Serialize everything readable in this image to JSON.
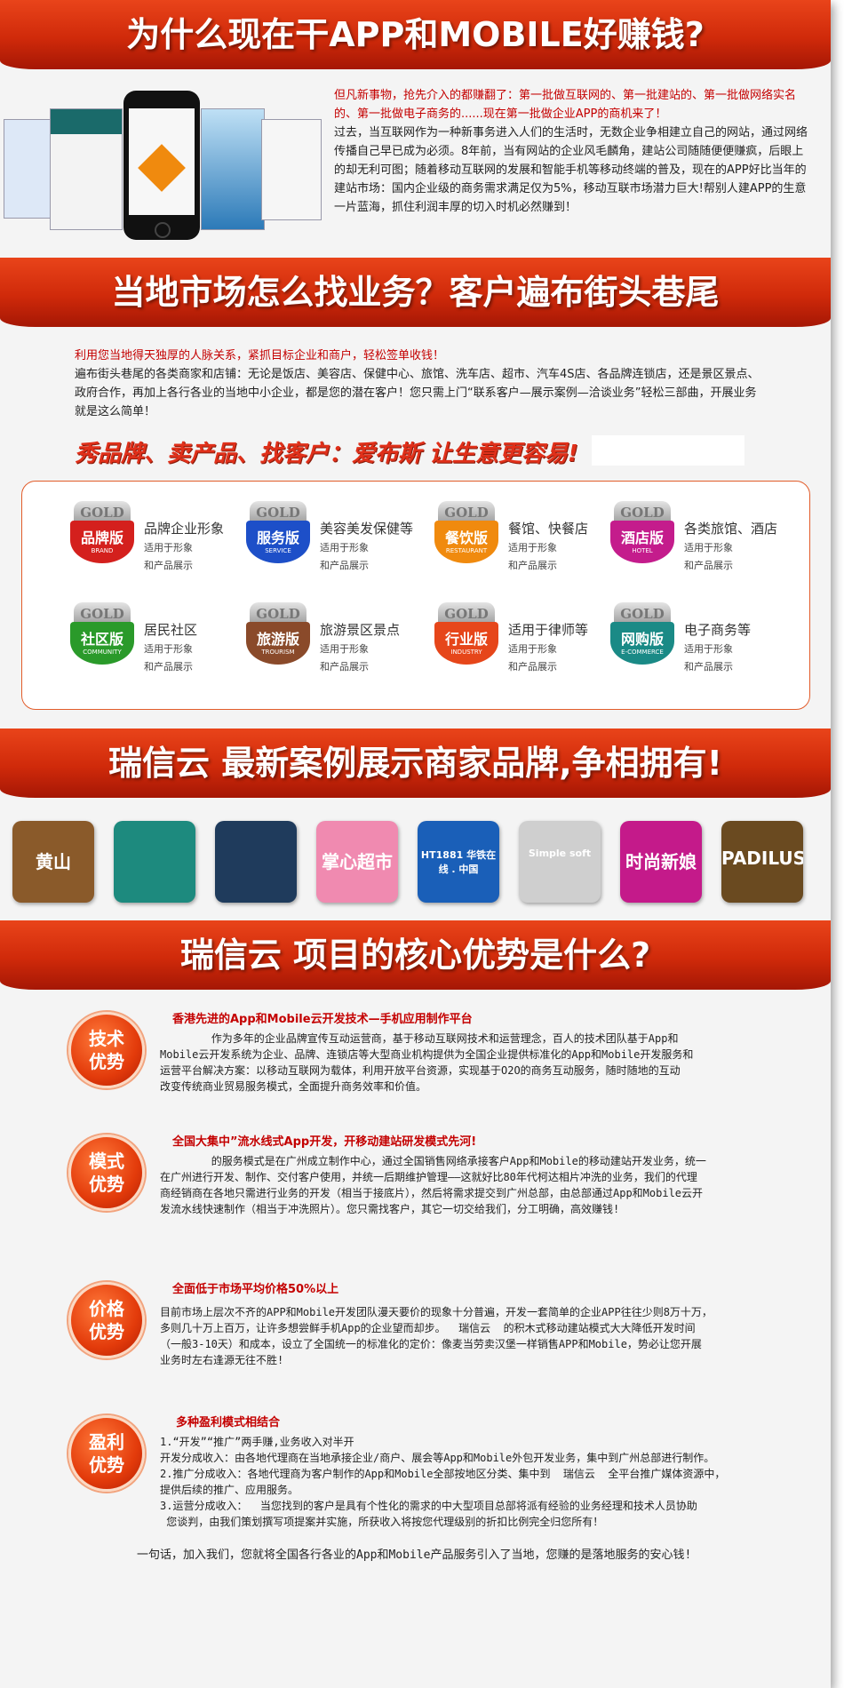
{
  "banner1": "为什么现在干APP和MOBILE好赚钱?",
  "intro": {
    "highlight": "但凡新事物，抢先介入的都赚翻了：第一批做互联网的、第一批建站的、第一批做网络实名的、第一批做电子商务的......现在第一批做企业APP的商机来了！",
    "body": "过去，当互联网作为一种新事务进入人们的生活时，无数企业争相建立自己的网站，通过网络传播自己早已成为必须。8年前，当有网站的企业风毛麟角，建站公司随随便便赚疯，后眼上的却无利可图；随着移动互联网的发展和智能手机等移动终端的普及，现在的APP好比当年的建站市场：国内企业级的商务需求满足仅为5%，移动互联市场潜力巨大!帮别人建APP的生意一片蓝海，抓住利润丰厚的切入时机必然赚到！"
  },
  "banner2": "当地市场怎么找业务？客户遍布街头巷尾",
  "local": {
    "highlight": "利用您当地得天独厚的人脉关系，紧抓目标企业和商户，轻松签单收钱！",
    "body": "遍布街头巷尾的各类商家和店铺：无论是饭店、美容店、保健中心、旅馆、洗车店、超市、汽车4S店、各品牌连锁店，还是景区景点、政府合作，再加上各行各业的当地中小企业，都是您的潜在客户！您只需上门“联系客户—展示案例—洽谈业务”轻松三部曲，开展业务就是这么简单！",
    "slogan": "秀品牌、卖产品、找客户：爱布斯 让生意更容易!"
  },
  "badges": [
    {
      "gold": "GOLD",
      "zh": "品牌版",
      "en": "BRAND",
      "title": "品牌企业形象",
      "line1": "适用于形象",
      "line2": "和产品展示",
      "color": "#d4201d"
    },
    {
      "gold": "GOLD",
      "zh": "服务版",
      "en": "SERVICE",
      "title": "美容美发保健等",
      "line1": "适用于形象",
      "line2": "和产品展示",
      "color": "#1d4fc8"
    },
    {
      "gold": "GOLD",
      "zh": "餐饮版",
      "en": "RESTAURANT",
      "title": "餐馆、快餐店",
      "line1": "适用于形象",
      "line2": "和产品展示",
      "color": "#f08a0e"
    },
    {
      "gold": "GOLD",
      "zh": "酒店版",
      "en": "HOTEL",
      "title": "各类旅馆、酒店",
      "line1": "适用于形象",
      "line2": "和产品展示",
      "color": "#c41c8c"
    },
    {
      "gold": "GOLD",
      "zh": "社区版",
      "en": "COMMUNITY",
      "title": "居民社区",
      "line1": "适用于形象",
      "line2": "和产品展示",
      "color": "#2a9a2a"
    },
    {
      "gold": "GOLD",
      "zh": "旅游版",
      "en": "TROURISM",
      "title": "旅游景区景点",
      "line1": "适用于形象",
      "line2": "和产品展示",
      "color": "#8a4a2a"
    },
    {
      "gold": "GOLD",
      "zh": "行业版",
      "en": "INDUSTRY",
      "title": "适用于律师等",
      "line1": "适用于形象",
      "line2": "和产品展示",
      "color": "#e6461a"
    },
    {
      "gold": "GOLD",
      "zh": "网购版",
      "en": "E-COMMERCE",
      "title": "电子商务等",
      "line1": "适用于形象",
      "line2": "和产品展示",
      "color": "#1a8a86"
    }
  ],
  "banner3": "瑞信云  最新案例展示商家品牌,争相拥有!",
  "logos": [
    {
      "text": "黄山",
      "bg": "#8a5a2a"
    },
    {
      "text": "",
      "bg": "#1d8a7e"
    },
    {
      "text": "",
      "bg": "#1f3b5c"
    },
    {
      "text": "掌心超市",
      "bg": "#f08ab0"
    },
    {
      "text": "HT1881 华铁在线 . 中国",
      "bg": "#1a5fb8"
    },
    {
      "text": "Simple soft",
      "bg": "#cfcfcf"
    },
    {
      "text": "时尚新娘",
      "bg": "#c41a8a"
    },
    {
      "text": "PADILUS",
      "bg": "#6a4a20"
    }
  ],
  "banner4": "瑞信云  项目的核心优势是什么?",
  "advantages": [
    {
      "c1": "技术",
      "c2": "优势",
      "heading": "香港先进的App和Mobile云开发技术—手机应用制作平台",
      "lines": [
        "        作为多年的企业品牌宣传互动运营商，基于移动互联网技术和运营理念，百人的技术团队基于App和",
        "Mobile云开发系统为企业、品牌、连锁店等大型商业机构提供为全国企业提供标准化的App和Mobile开发服务和",
        "运营平台解决方案：以移动互联网为载体，利用开放平台资源，实现基于O2O的商务互动服务，随时随地的互动",
        "改变传统商业贸易服务模式，全面提升商务效率和价值。"
      ]
    },
    {
      "c1": "模式",
      "c2": "优势",
      "heading": "全国大集中”流水线式App开发，开移动建站研发模式先河!",
      "lines": [
        "        的服务模式是在广州成立制作中心，通过全国销售网络承接客户App和Mobile的移动建站开发业务，统一",
        "在广州进行开发、制作、交付客户使用，并统一后期维护管理——这就好比80年代柯达相片冲洗的业务，我们的代理",
        "商经销商在各地只需进行业务的开发（相当于接底片），然后将需求提交到广州总部，由总部通过App和Mobile云开",
        "发流水线快速制作（相当于冲洗照片）。您只需找客户，其它一切交给我们，分工明确，高效赚钱!"
      ]
    },
    {
      "c1": "价格",
      "c2": "优势",
      "heading": "全面低于市场平均价格50%以上",
      "lines": [
        "目前市场上层次不齐的APP和Mobile开发团队漫天要价的现象十分普遍，开发一套简单的企业APP往往少则8万十万，",
        "多则几十万上百万，让许多想尝鲜手机App的企业望而却步。  瑞信云  的积木式移动建站模式大大降低开发时间",
        "（一般3-10天）和成本，设立了全国统一的标准化的定价：像麦当劳卖汉堡一样销售APP和Mobile，势必让您开展",
        "业务时左右逢源无往不胜!"
      ]
    },
    {
      "c1": "盈利",
      "c2": "优势",
      "heading": "多种盈利模式相结合",
      "lines": [
        "1.“开发”“推广”两手赚,业务收入对半开",
        "开发分成收入：由各地代理商在当地承接企业/商户、展会等App和Mobile外包开发业务，集中到广州总部进行制作。",
        "2.推广分成收入：各地代理商为客户制作的App和Mobile全部按地区分类、集中到  瑞信云  全平台推广媒体资源中，",
        "提供后续的推广、应用服务。",
        "3.运营分成收入：  当您找到的客户是具有个性化的需求的中大型项目总部将派有经验的业务经理和技术人员协助",
        " 您谈判，由我们策划撰写项提案并实施，所获收入将按您代理级别的折扣比例完全归您所有！"
      ]
    }
  ],
  "closing": "一句话，加入我们，您就将全国各行各业的App和Mobile产品服务引入了当地，您赚的是落地服务的安心钱!"
}
